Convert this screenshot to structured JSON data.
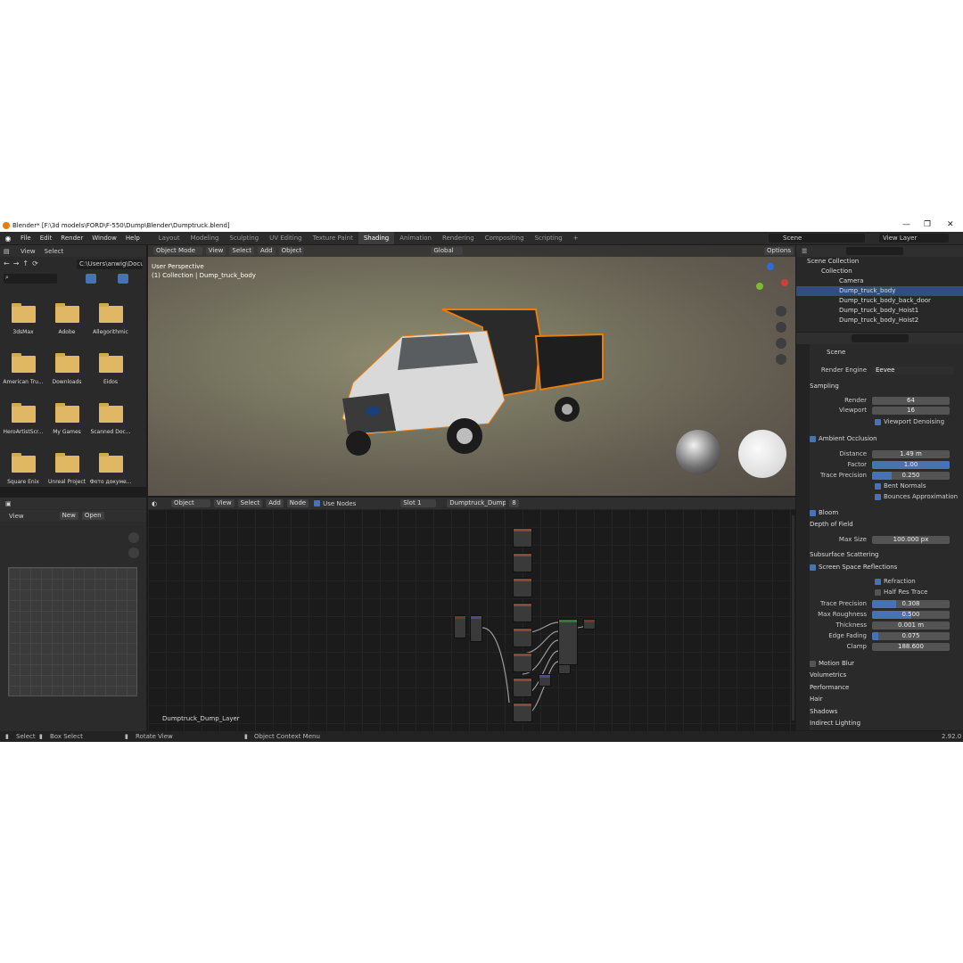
{
  "window": {
    "title": "Blender* [F:\\3d models\\FORD\\F-550\\Dump\\Blender\\Dumptruck.blend]",
    "minimize": "—",
    "maximize": "❐",
    "close": "✕"
  },
  "menu": [
    "File",
    "Edit",
    "Render",
    "Window",
    "Help"
  ],
  "workspaces": [
    "Layout",
    "Modeling",
    "Sculpting",
    "UV Editing",
    "Texture Paint",
    "Shading",
    "Animation",
    "Rendering",
    "Compositing",
    "Scripting",
    "+"
  ],
  "scene": {
    "name": "Scene",
    "view_layer": "View Layer"
  },
  "file_browser": {
    "view": "View",
    "select": "Select",
    "path": "C:\\Users\\anwig\\Docu...",
    "folders": [
      "3dsMax",
      "Adobe",
      "Allegorithmic",
      "American Tru...",
      "Downloads",
      "Eidos",
      "HeroArtistScr...",
      "My Games",
      "Scanned Doc...",
      "Square Enix",
      "Unreal Project",
      "Фото докуме..."
    ]
  },
  "image_editor": {
    "view": "View",
    "new": "New",
    "open": "Open"
  },
  "viewport": {
    "mode": "Object Mode",
    "menus": [
      "View",
      "Select",
      "Add",
      "Object"
    ],
    "transform": "Global",
    "options": "Options",
    "overlay_title": "User Perspective",
    "overlay_sub": "(1) Collection | Dump_truck_body"
  },
  "outliner": {
    "root": "Scene Collection",
    "collection": "Collection",
    "items": [
      "Camera",
      "Dump_truck_body",
      "Dump_truck_body_back_door",
      "Dump_truck_body_Hoist1",
      "Dump_truck_body_Hoist2"
    ]
  },
  "properties": {
    "scene_label": "Scene",
    "render_engine_label": "Render Engine",
    "render_engine": "Eevee",
    "sampling": "Sampling",
    "render_label": "Render",
    "render_val": "64",
    "viewport_label": "Viewport",
    "viewport_val": "16",
    "viewport_denoising": "Viewport Denoising",
    "ao": "Ambient Occlusion",
    "distance_label": "Distance",
    "distance": "1.49 m",
    "factor_label": "Factor",
    "factor": "1.00",
    "factor_frac": 1.0,
    "trace_precision_label": "Trace Precision",
    "ao_trace": "0.250",
    "ao_trace_frac": 0.25,
    "bent_normals": "Bent Normals",
    "bounces": "Bounces Approximation",
    "bloom": "Bloom",
    "dof": "Depth of Field",
    "max_size_label": "Max Size",
    "max_size": "100.000 px",
    "sss": "Subsurface Scattering",
    "ssr": "Screen Space Reflections",
    "refraction": "Refraction",
    "half_res": "Half Res Trace",
    "ssr_trace": "0.308",
    "ssr_trace_frac": 0.308,
    "max_roughness_label": "Max Roughness",
    "max_roughness": "0.500",
    "max_roughness_frac": 0.5,
    "thickness_label": "Thickness",
    "thickness": "0.001 m",
    "edge_fading_label": "Edge Fading",
    "edge_fading": "0.075",
    "edge_fading_frac": 0.075,
    "clamp_label": "Clamp",
    "clamp": "188.600",
    "collapsed": [
      "Motion Blur",
      "Volumetrics",
      "Performance",
      "Hair",
      "Shadows",
      "Indirect Lighting"
    ]
  },
  "node_editor": {
    "object": "Object",
    "menus": [
      "View",
      "Select",
      "Add",
      "Node"
    ],
    "use_nodes": "Use Nodes",
    "slot": "Slot 1",
    "material": "Dumptruck_Dump_L...",
    "users": "8",
    "layer_label": "Dumptruck_Dump_Layer"
  },
  "status": {
    "select": "Select",
    "box_select": "Box Select",
    "rotate": "Rotate View",
    "context_menu": "Object Context Menu",
    "version": "2.92.0"
  },
  "colors": {
    "accent": "#4772b3",
    "selection": "#e87d0d",
    "folder": "#e0b864"
  }
}
